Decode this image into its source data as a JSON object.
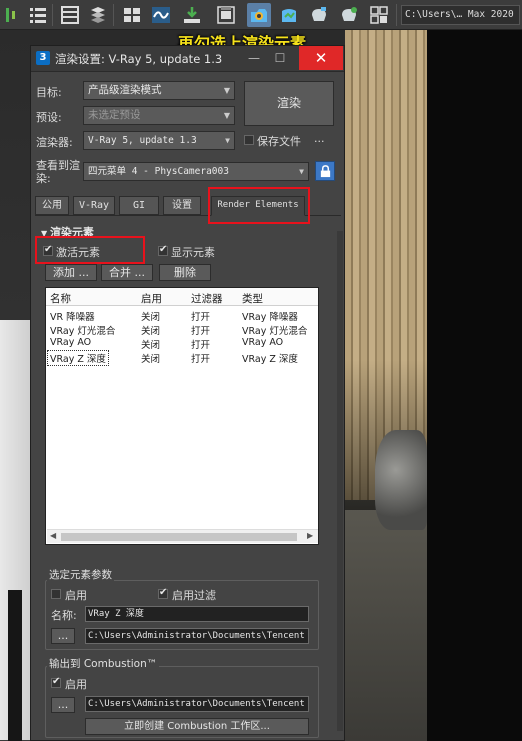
{
  "toolbar": {
    "path_text": "C:\\Users\\… Max 2020"
  },
  "caption": "再勾选上渲染元素",
  "dialog": {
    "app_icon_text": "3",
    "title": "渲染设置: V-Ray 5, update 1.3",
    "min_symbol": "—",
    "max_symbol": "☐",
    "close_symbol": "✕",
    "target_label": "目标:",
    "target_value": "产品级渲染模式",
    "preset_label": "预设:",
    "preset_value": "未选定预设",
    "renderer_label": "渲染器:",
    "renderer_value": "V-Ray 5, update 1.3",
    "save_file_label": "保存文件",
    "save_file_checked": false,
    "ellipsis": "...",
    "view_label_1": "查看到渲",
    "view_label_2": "染:",
    "view_value": "四元菜单 4 - PhysCamera003",
    "render_button": "渲染",
    "tabs": [
      "公用",
      "V-Ray",
      "GI",
      "设置",
      "Render Elements"
    ],
    "active_tab": "Render Elements",
    "section_title": "渲染元素",
    "activate_elements_label": "激活元素",
    "activate_elements_checked": true,
    "display_elements_label": "显示元素",
    "display_elements_checked": true,
    "add_button": "添加 ...",
    "merge_button": "合并 ...",
    "delete_button": "删除",
    "list_headers": [
      "名称",
      "启用",
      "过滤器",
      "类型"
    ],
    "list_rows": [
      [
        "VR 降噪器",
        "关闭",
        "打开",
        "VRay 降噪器"
      ],
      [
        "VRay 灯光混合",
        "关闭",
        "打开",
        "VRay 灯光混合"
      ],
      [
        "VRay AO",
        "关闭",
        "打开",
        "VRay AO"
      ],
      [
        "VRay Z 深度",
        "关闭",
        "打开",
        "VRay Z 深度"
      ]
    ],
    "selected_row": 3,
    "params_group_title": "选定元素参数",
    "enable_label": "启用",
    "enable_checked": false,
    "enable_filter_label": "启用过滤",
    "enable_filter_checked": true,
    "name_label": "名称:",
    "name_value": "VRay Z 深度",
    "browse_button": "...",
    "path_value": "C:\\Users\\Administrator\\Documents\\Tencent",
    "combustion_group_title": "输出到 Combustion™",
    "combustion_enable_label": "启用",
    "combustion_enable_checked": true,
    "combustion_path_value": "C:\\Users\\Administrator\\Documents\\Tencent",
    "create_combustion_button": "立即创建 Combustion 工作区..."
  }
}
